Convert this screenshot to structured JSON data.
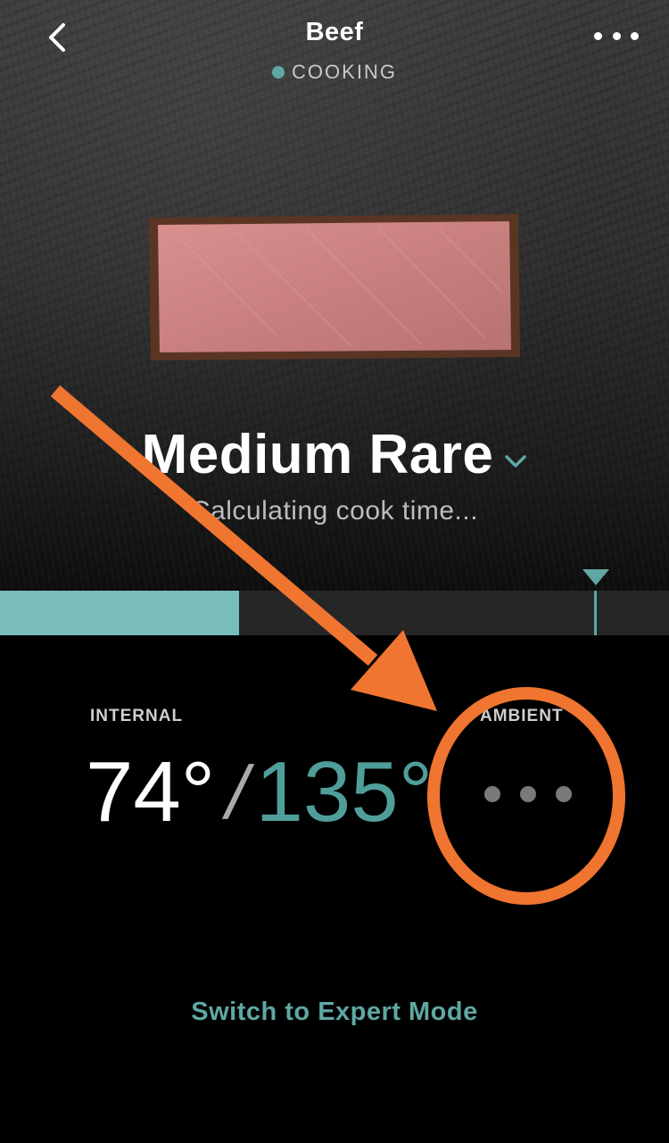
{
  "header": {
    "title": "Beef",
    "status": "COOKING",
    "back_icon": "chevron-left-icon",
    "menu_icon": "more-horizontal-icon"
  },
  "doneness": {
    "label": "Medium Rare",
    "dropdown_icon": "chevron-down-icon",
    "subtitle": "Calculating cook time..."
  },
  "progress": {
    "current_fraction": 0.357,
    "target_fraction": 0.889
  },
  "readings": {
    "internal_label": "INTERNAL",
    "internal_temp": "74°",
    "separator": "/",
    "target_temp": "135°",
    "ambient_label": "AMBIENT",
    "ambient_state": "loading-dots"
  },
  "footer": {
    "expert_mode_label": "Switch to Expert Mode"
  },
  "colors": {
    "accent_teal": "#5fa7a4",
    "progress_fill": "#79bdb9",
    "annotation_orange": "#ef7530",
    "background": "#000000"
  }
}
